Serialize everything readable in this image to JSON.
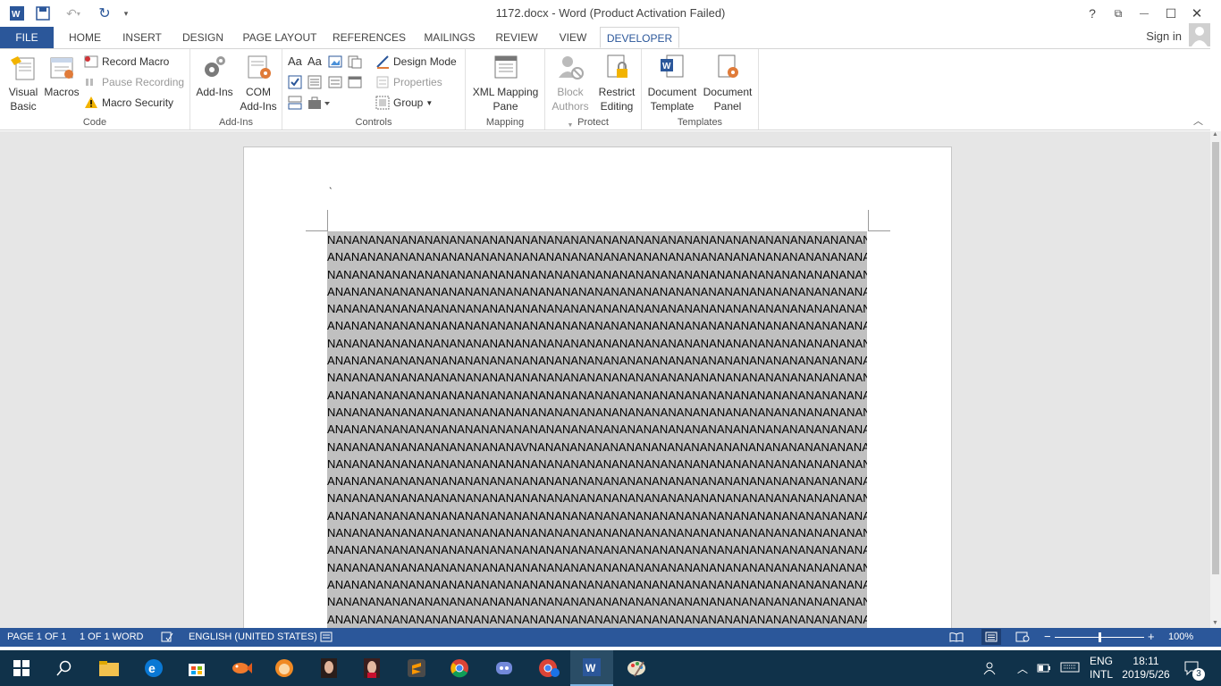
{
  "window": {
    "title": "1172.docx - Word (Product Activation Failed)",
    "help": "?",
    "restore": "⧉",
    "minimize": "—",
    "maximize": "☐",
    "close": "✕"
  },
  "tabs": [
    {
      "label": "FILE"
    },
    {
      "label": "HOME"
    },
    {
      "label": "INSERT"
    },
    {
      "label": "DESIGN"
    },
    {
      "label": "PAGE LAYOUT"
    },
    {
      "label": "REFERENCES"
    },
    {
      "label": "MAILINGS"
    },
    {
      "label": "REVIEW"
    },
    {
      "label": "VIEW"
    },
    {
      "label": "DEVELOPER"
    }
  ],
  "sign_in": "Sign in",
  "ribbon": {
    "code": {
      "label": "Code",
      "visual_basic": [
        "Visual",
        "Basic"
      ],
      "macros": "Macros",
      "record_macro": "Record Macro",
      "pause_recording": "Pause Recording",
      "macro_security": "Macro Security"
    },
    "addins": {
      "label": "Add-Ins",
      "addins": "Add-Ins",
      "com_addins": [
        "COM",
        "Add-Ins"
      ]
    },
    "controls": {
      "label": "Controls",
      "design_mode": "Design Mode",
      "properties": "Properties",
      "group": "Group"
    },
    "mapping": {
      "label": "Mapping",
      "xml_mapping": [
        "XML Mapping",
        "Pane"
      ]
    },
    "protect": {
      "label": "Protect",
      "block_authors": [
        "Block",
        "Authors"
      ],
      "restrict_editing": [
        "Restrict",
        "Editing"
      ]
    },
    "templates": {
      "label": "Templates",
      "document_template": [
        "Document",
        "Template"
      ],
      "document_panel": [
        "Document",
        "Panel"
      ]
    }
  },
  "document": {
    "tick": "`",
    "lines": [
      "NANANANANANANANANANANANANANANANANANANANANANANANANANANANANANANANANANANANANANAN",
      "ANANANANANANANANANANANANANANANANANANANANANANANANANANANANANANANANANANANANANANA",
      "NANANANANANANANANANANANANANANANANANANANANANANANANANANANANANANANANANANANANANAN",
      "ANANANANANANANANANANANANANANANANANANANANANANANANANANANANANANANANANANANANANANA",
      "NANANANANANANANANANANANANANANANANANANANANANANANANANANANANANANANANANANANANANAN",
      "ANANANANANANANANANANANANANANANANANANANANANANANANANANANANANANANANANANANANANANA",
      "NANANANANANANANANANANANANANANANANANANANANANANANANANANANANANANANANANANANANANAN",
      "ANANANANANANANANANANANANANANANANANANANANANANANANANANANANANANANANANANANANANANA",
      "NANANANANANANANANANANANANANANANANANANANANANANANANANANANANANANANANANANANANANAN",
      "ANANANANANANANANANANANANANANANANANANANANANANANANANANANANANANANANANANANANANANA",
      "NANANANANANANANANANANANANANANANANANANANANANANANANANANANANANANANANANANANANANAN",
      "ANANANANANANANANANANANANANANANANANANANANANANANANANANANANANANANANANANANANANANA",
      "NANANANANANANANANANANANAVNANANANANANANANANANANANANANANANANANANANANANANANANAN",
      "NANANANANANANANANANANANANANANANANANANANANANANANANANANANANANANANANANANANANANAN",
      "ANANANANANANANANANANANANANANANANANANANANANANANANANANANANANANANANANANANANANANA",
      "NANANANANANANANANANANANANANANANANANANANANANANANANANANANANANANANANANANANANANAN",
      "ANANANANANANANANANANANANANANANANANANANANANANANANANANANANANANANANANANANANANANA",
      "NANANANANANANANANANANANANANANANANANANANANANANANANANANANANANANANANANANANANANAN",
      "ANANANANANANANANANANANANANANANANANANANANANANANANANANANANANANANANANANANANANANA",
      "NANANANANANANANANANANANANANANANANANANANANANANANANANANANANANANANANANANANANANAN",
      "ANANANANANANANANANANANANANANANANANANANANANANANANANANANANANANANANANANANANANANA",
      "NANANANANANANANANANANANANANANANANANANANANANANANANANANANANANANANANANANANANANAN",
      "ANANANANANANANANANANANANANANANANANANANANANANANANANANANANANANANANANANANANANANA"
    ]
  },
  "statusbar": {
    "page": "PAGE 1 OF 1",
    "words": "1 OF 1 WORD",
    "language": "ENGLISH (UNITED STATES)",
    "zoom": "100%",
    "zoom_minus": "−",
    "zoom_plus": "+",
    "zoom_level": 0.5
  },
  "taskbar": {
    "lang": "ENG",
    "layout": "INTL",
    "time": "18:11",
    "date": "2019/5/26",
    "notifications": "3"
  },
  "colors": {
    "word_blue": "#2b579a",
    "taskbar": "#10324a",
    "selection": "#c0c0c0"
  }
}
